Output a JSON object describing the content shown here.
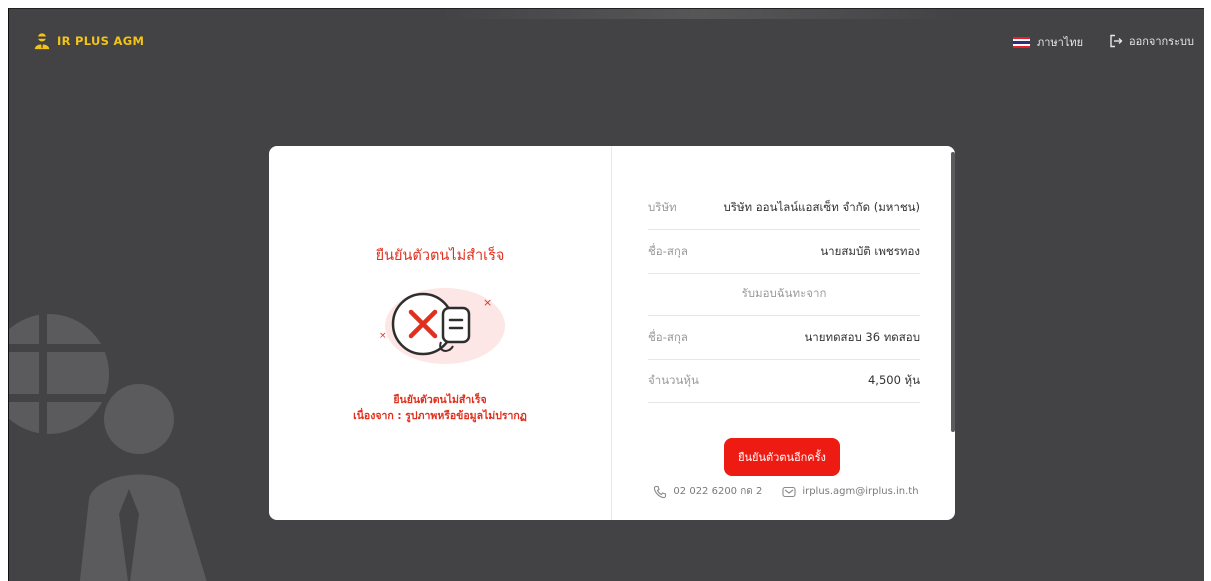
{
  "header": {
    "logo_text": "IR PLUS AGM",
    "language_label": "ภาษาไทย",
    "logout_label": "ออกจากระบบ"
  },
  "result": {
    "title": "ยืนยันตัวตนไม่สำเร็จ",
    "message_line1": "ยืนยันตัวตนไม่สำเร็จ",
    "message_line2": "เนื่องจาก : รูปภาพหรือข้อมูลไม่ปรากฏ"
  },
  "details": {
    "company_label": "บริษัท",
    "company_value": "บริษัท ออนไลน์แอสเซ็ท จำกัด (มหาชน)",
    "name_label": "ชื่อ-สกุล",
    "name_value": "นายสมบัติ เพชรทอง",
    "proxy_from_label": "รับมอบฉันทะจาก",
    "proxy_name_label": "ชื่อ-สกุล",
    "proxy_name_value": "นายทดสอบ 36 ทดสอบ",
    "shares_label": "จำนวนหุ้น",
    "shares_value": "4,500 หุ้น"
  },
  "actions": {
    "retry_label": "ยืนยันตัวตนอีกครั้ง"
  },
  "contact": {
    "phone": "02 022 6200 กด 2",
    "email": "irplus.agm@irplus.in.th"
  },
  "colors": {
    "background": "#434345",
    "accent_red": "#ee1b12",
    "error_text": "#e0311f",
    "logo_yellow": "#f2c318"
  },
  "icons": {
    "logo": "mascot-icon",
    "language": "thai-flag-icon",
    "logout": "logout-icon",
    "phone": "phone-icon",
    "email": "email-icon",
    "failure": "failed-document-icon"
  }
}
